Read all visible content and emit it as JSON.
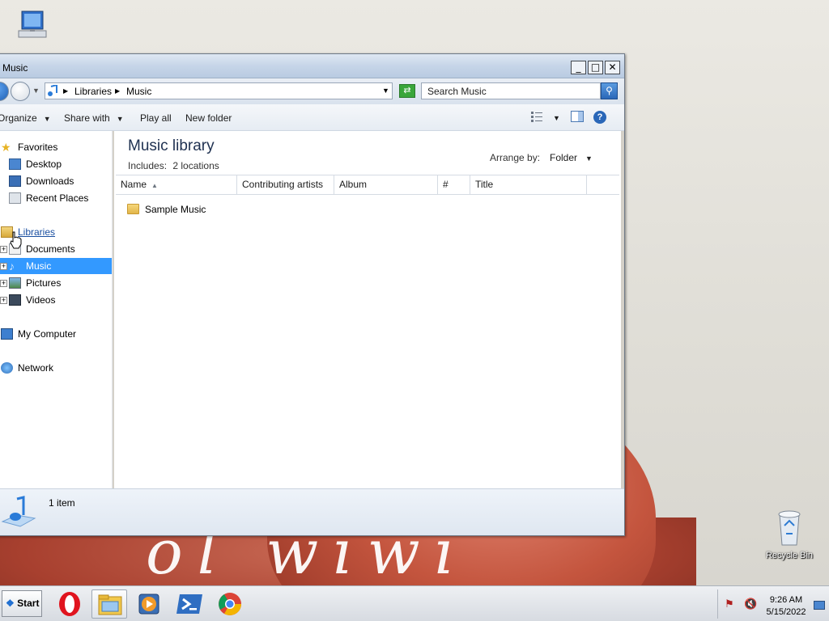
{
  "desktop": {
    "icons": [
      {
        "name": "My Computer",
        "label": ""
      },
      {
        "name": "Recycle Bin",
        "label": "Recycle Bin"
      }
    ],
    "wallpaper_text": "ol wiwi"
  },
  "window": {
    "title": "Music",
    "controls": {
      "minimize": "_",
      "maximize": "□",
      "close": "✕"
    },
    "address": {
      "crumbs": [
        "Libraries",
        "Music"
      ],
      "search_placeholder": "Search Music"
    },
    "toolbar": {
      "organize": "Organize",
      "share_with": "Share with",
      "play_all": "Play all",
      "new_folder": "New folder"
    },
    "nav": {
      "favorites": "Favorites",
      "favorites_items": [
        "Desktop",
        "Downloads",
        "Recent Places"
      ],
      "libraries": "Libraries",
      "libraries_items": [
        "Documents",
        "Music",
        "Pictures",
        "Videos"
      ],
      "selected": "Music",
      "computer": "My Computer",
      "network": "Network"
    },
    "content": {
      "title": "Music library",
      "includes_label": "Includes:",
      "includes_value": "2 locations",
      "arrange_label": "Arrange by:",
      "arrange_value": "Folder",
      "columns": [
        "Name",
        "Contributing artists",
        "Album",
        "#",
        "Title"
      ],
      "items": [
        {
          "name": "Sample Music",
          "type": "folder"
        }
      ]
    },
    "status": {
      "count": "1 item"
    }
  },
  "taskbar": {
    "start_label": "Start",
    "apps": [
      "opera-icon",
      "file-explorer-icon",
      "media-player-icon",
      "powershell-icon",
      "chrome-icon"
    ],
    "clock_time": "9:26 AM",
    "clock_date": "5/15/2022"
  },
  "colors": {
    "selection": "#3399ff",
    "link": "#1a4fa0",
    "title_text": "#1e3050"
  }
}
